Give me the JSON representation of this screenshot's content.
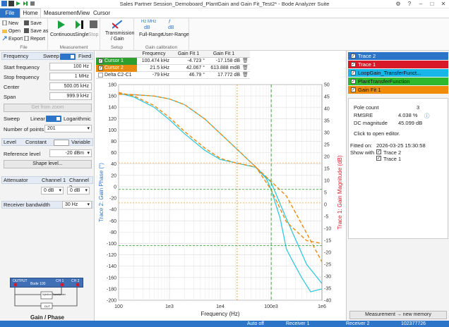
{
  "window": {
    "title": "Sales Partner Session_Demoboard_PlantGain and Gain Fit_Test2* - Bode Analyzer Suite"
  },
  "menu": {
    "file": "File",
    "home": "Home",
    "measurement": "Measurement",
    "view": "View",
    "cursor": "Cursor"
  },
  "ribbon": {
    "file": {
      "new": "New",
      "open": "Open",
      "export": "Export",
      "save": "Save",
      "save_as": "Save as",
      "report": "Report",
      "group": "File"
    },
    "measurement": {
      "continuous": "Continuous",
      "single": "Single",
      "stop": "Stop",
      "group": "Measurement"
    },
    "setup": {
      "transmission": "Transmission",
      "gain": "/ Gain",
      "group": "Setup"
    },
    "calibration": {
      "full_range": "Full-Range",
      "user_range": "User-Range",
      "db": "dB",
      "hz_mhz": "Hz MHz",
      "f_sym": "f",
      "group": "Gain calibration"
    }
  },
  "left": {
    "frequency": {
      "title": "Frequency",
      "sweep": "Sweep",
      "fixed": "Fixed",
      "start_label": "Start frequency",
      "start": "100 Hz",
      "stop_label": "Stop frequency",
      "stop": "1 MHz",
      "center_label": "Center",
      "center": "500.05 kHz",
      "span_label": "Span",
      "span": "999.9 kHz",
      "get_zoom": "Get from zoom",
      "sweep_label": "Sweep",
      "linear": "Linear",
      "log": "Logarithmic",
      "points_label": "Number of points",
      "points": "201"
    },
    "level": {
      "title": "Level",
      "constant": "Constant",
      "variable": "Variable",
      "ref_label": "Reference level",
      "ref": "-20 dBm",
      "shape": "Shape level..."
    },
    "attenuator": {
      "title": "Attenuator",
      "ch1": "Channel 1",
      "ch2": "Channel 2",
      "ch1_val": "0 dB",
      "ch2_val": "0 dB"
    },
    "rbw": {
      "title": "Receiver bandwidth",
      "value": "30 Hz"
    },
    "device": {
      "caption": "Gain / Phase",
      "output": "OUTPUT",
      "bode": "Bode 100",
      "ch1": "CH 1",
      "ch2": "CH 2",
      "dut": "DUT",
      "injector": "Injection Transformer"
    }
  },
  "cursors": {
    "headers": [
      "Frequency",
      "Gain Fit 1",
      "Gain Fit 1"
    ],
    "rows": [
      {
        "name": "Cursor 1",
        "freq": "100.474 kHz",
        "phase": "-4.723 °",
        "mag": "-17.158 dB",
        "color": "#2e9e2e"
      },
      {
        "name": "Cursor 2",
        "freq": "21.5 kHz",
        "phase": "42.067 °",
        "mag": "613.888 mdB",
        "color": "#e98b11"
      },
      {
        "name": "Delta C2-C1",
        "freq": "-79 kHz",
        "phase": "46.79 °",
        "mag": "17.772 dB",
        "color": "#fff"
      }
    ]
  },
  "chart_data": {
    "type": "line",
    "xlabel": "Frequency (Hz)",
    "ylabel": "Trace 2: Gain Phase (°)",
    "y2label": "Trace 1: Gain Magnitude (dB)",
    "x_ticks": [
      "100",
      "1e3",
      "1e4",
      "1e5",
      "1e6"
    ],
    "x_tick_labels": [
      "100",
      "1e3",
      "1e4",
      "100e3",
      "1e6"
    ],
    "xlim": [
      100,
      1000000
    ],
    "xscale": "log",
    "ylim": [
      -200,
      180
    ],
    "y_ticks": [
      "180",
      "160",
      "140",
      "120",
      "100",
      "80",
      "60",
      "40",
      "20",
      "0",
      "-20",
      "-40",
      "-60",
      "-80",
      "-100",
      "-120",
      "-140",
      "-160",
      "-180",
      "-200"
    ],
    "y2lim": [
      -40,
      50
    ],
    "y2_ticks": [
      "50",
      "45",
      "40",
      "35",
      "30",
      "25",
      "20",
      "15",
      "10",
      "5",
      "0",
      "-5",
      "-10",
      "-15",
      "-20",
      "-25",
      "-30",
      "-35",
      "-40"
    ],
    "cursors_x": [
      21500,
      100474
    ],
    "phase_trace": {
      "name": "Trace 2",
      "color": "#26c6da",
      "x": [
        100,
        200,
        500,
        1000,
        2000,
        5000,
        10000,
        20000,
        50000,
        80000,
        100000,
        150000,
        200000,
        300000,
        400000,
        600000,
        1000000
      ],
      "y": [
        165,
        158,
        140,
        118,
        93,
        64,
        48,
        42,
        34,
        15,
        -5,
        -55,
        -110,
        -140,
        -160,
        -185,
        -180
      ]
    },
    "phase_fit": {
      "name": "Gain Fit 1",
      "color": "#ef8a10",
      "x": [
        100,
        200,
        500,
        1000,
        2000,
        5000,
        10000,
        20000,
        50000,
        100000,
        200000,
        500000,
        1000000
      ],
      "y": [
        166,
        160,
        143,
        122,
        97,
        68,
        50,
        42,
        35,
        -5,
        -62,
        -95,
        -100
      ]
    },
    "mag_trace": {
      "name": "Trace 1",
      "color": "#26c6da",
      "x": [
        100,
        200,
        500,
        1000,
        2000,
        5000,
        10000,
        20000,
        50000,
        100000,
        200000,
        500000,
        1000000
      ],
      "y": [
        46,
        45.8,
        45.2,
        44,
        41.6,
        35.6,
        29.6,
        23.6,
        15.6,
        9.2,
        -6,
        -25,
        -33
      ]
    },
    "mag_fit": {
      "name": "Gain Fit 1",
      "color": "#ef8a10",
      "x": [
        100,
        200,
        500,
        1000,
        2000,
        5000,
        10000,
        20000,
        50000,
        100000,
        200000,
        500000,
        1000000
      ],
      "y": [
        46,
        45.8,
        45.2,
        44,
        41.6,
        35.6,
        29.6,
        23.6,
        15.6,
        9.6,
        3.5,
        -12,
        -24
      ]
    }
  },
  "traces": {
    "items": [
      {
        "label": "Trace 2",
        "color": "#2b74c8"
      },
      {
        "label": "Trace 1",
        "color": "#d8192a"
      },
      {
        "label": "LoopGain_TransferFunct...",
        "color": "#18b6e8"
      },
      {
        "label": "PlantTransferFunction",
        "color": "#2eb82e"
      },
      {
        "label": "Gain Fit 1",
        "color": "#f08c0a"
      }
    ],
    "fit": {
      "pole_label": "Pole count",
      "pole": "3",
      "rmsre_label": "RMSRE",
      "rmsre": "4.038 %",
      "dc_label": "DC magnitude",
      "dc": "45.099 dB",
      "hint": "Click to open editor.",
      "fitted_label": "Fitted on:",
      "fitted": "2026-03-25 15:30:58",
      "show_label": "Show with",
      "show1": "Trace 2",
      "show2": "Trace 1"
    },
    "new_memory": "Measurement → new memory"
  },
  "status": {
    "auto": "Auto off",
    "r1": "Receiver 1",
    "r2": "Receiver 2",
    "serial": "102377726"
  }
}
